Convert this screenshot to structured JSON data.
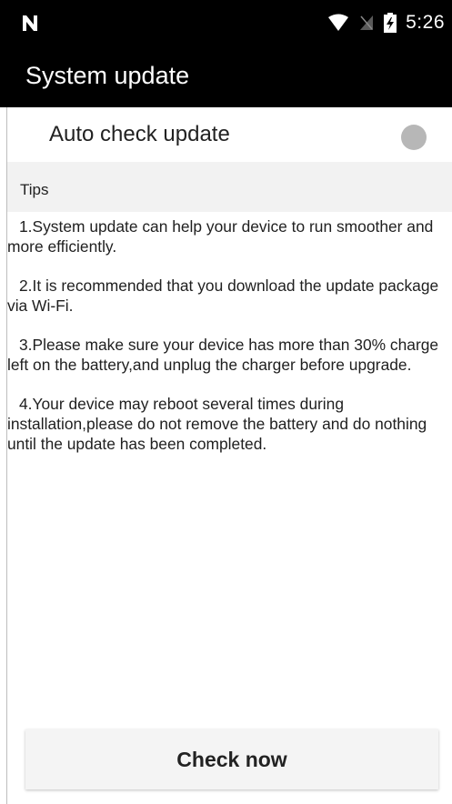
{
  "status_bar": {
    "time": "5:26",
    "icons": [
      "notification-n-icon",
      "wifi-icon",
      "no-sim-icon",
      "battery-charging-icon"
    ]
  },
  "app_bar": {
    "title": "System update"
  },
  "auto_check": {
    "label": "Auto check update",
    "enabled": false
  },
  "tips": {
    "header": "Tips",
    "items": [
      "1.System update can help your device to run smoother and more efficiently.",
      "2.It is recommended that you download the update package via Wi-Fi.",
      "3.Please make sure your device has more than 30% charge left on the battery,and unplug the charger before upgrade.",
      "4.Your device may reboot several times during installation,please do not remove the battery and do nothing until the update has been completed."
    ]
  },
  "actions": {
    "check_now_label": "Check now"
  },
  "colors": {
    "bar_background": "#000000",
    "toggle_off": "#b7b7b7",
    "tips_header_background": "#f2f2f2"
  }
}
